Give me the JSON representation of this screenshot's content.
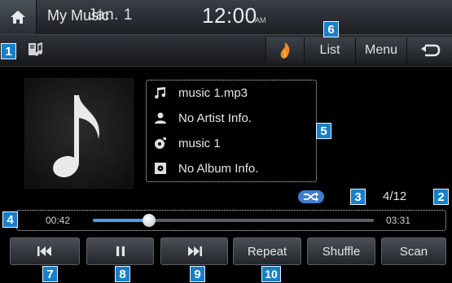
{
  "status_bar": {
    "date": "Jan.  1",
    "time": "12:00",
    "ampm": "AM"
  },
  "title_bar": {
    "title": "My Music",
    "list_label": "List",
    "menu_label": "Menu"
  },
  "song_info": {
    "file": "music 1.mp3",
    "artist": "No Artist Info.",
    "title": "music 1",
    "album": "No Album Info."
  },
  "playback": {
    "track_counter": "4/12",
    "elapsed": "00:42",
    "total": "03:31",
    "progress_fraction": 0.2,
    "shuffle_active": true
  },
  "controls": {
    "repeat_label": "Repeat",
    "shuffle_label": "Shuffle",
    "scan_label": "Scan"
  },
  "callouts": [
    "1",
    "2",
    "3",
    "4",
    "5",
    "6",
    "7",
    "8",
    "9",
    "10"
  ],
  "colors": {
    "callout": "#1680c8",
    "progress": "#4aa0e6",
    "shuffle_indicator": "#3d7ed0"
  }
}
